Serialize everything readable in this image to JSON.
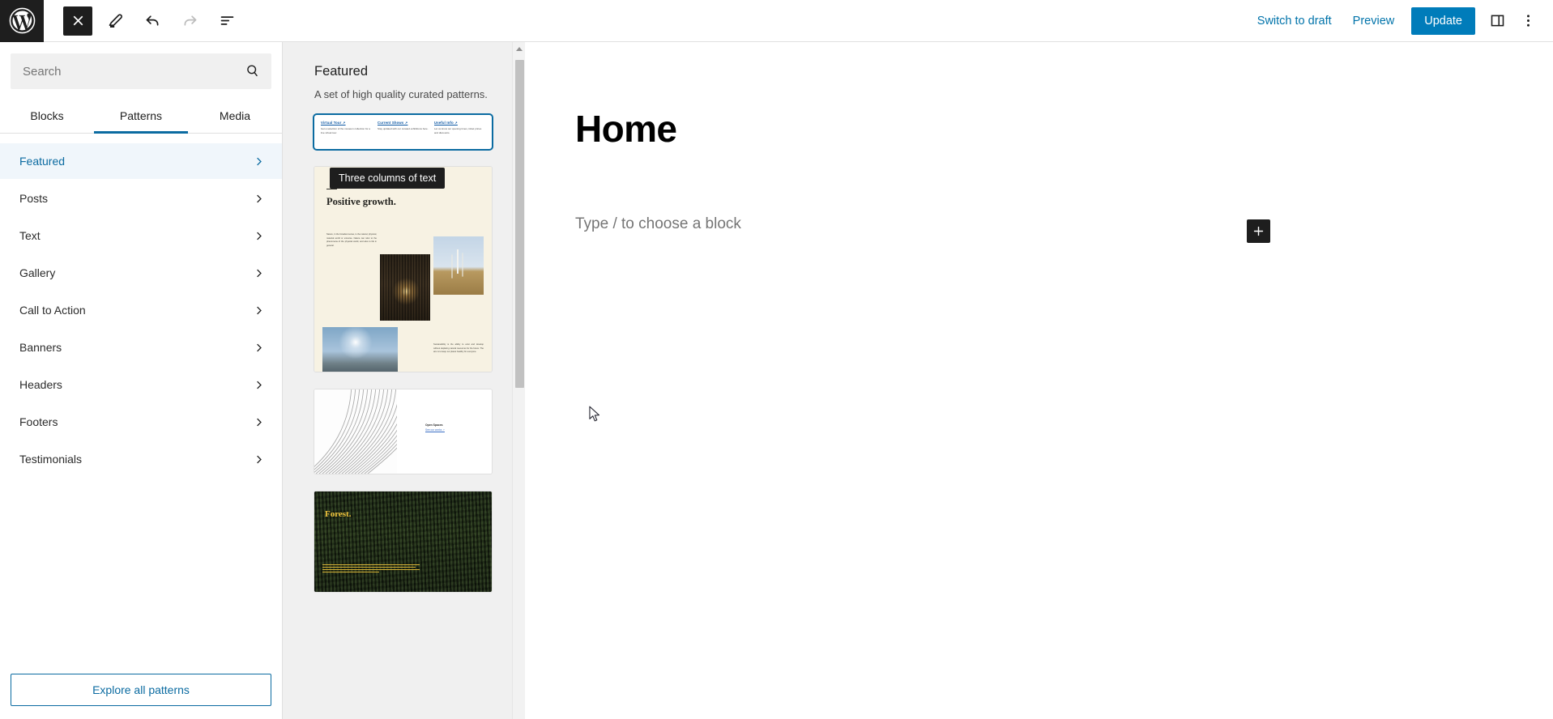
{
  "topbar": {
    "logo_icon": "wordpress-logo",
    "tools": [
      {
        "name": "close-inserter-button",
        "icon": "close-icon",
        "label": "Close block inserter"
      },
      {
        "name": "edit-mode-button",
        "icon": "pencil-icon",
        "label": "Tools"
      },
      {
        "name": "undo-button",
        "icon": "undo-icon",
        "label": "Undo"
      },
      {
        "name": "redo-button",
        "icon": "redo-icon",
        "label": "Redo"
      },
      {
        "name": "list-view-button",
        "icon": "list-view-icon",
        "label": "Document Overview"
      }
    ],
    "switch_to_draft": "Switch to draft",
    "preview": "Preview",
    "update": "Update",
    "settings_icon": "sidebar-toggle-icon",
    "options_icon": "more-options-icon"
  },
  "inserter": {
    "search": {
      "placeholder": "Search",
      "value": "",
      "icon": "search-icon"
    },
    "tabs": [
      {
        "label": "Blocks",
        "active": false
      },
      {
        "label": "Patterns",
        "active": true
      },
      {
        "label": "Media",
        "active": false
      }
    ],
    "categories": [
      {
        "label": "Featured",
        "active": true
      },
      {
        "label": "Posts",
        "active": false
      },
      {
        "label": "Text",
        "active": false
      },
      {
        "label": "Gallery",
        "active": false
      },
      {
        "label": "Call to Action",
        "active": false
      },
      {
        "label": "Banners",
        "active": false
      },
      {
        "label": "Headers",
        "active": false
      },
      {
        "label": "Footers",
        "active": false
      },
      {
        "label": "Testimonials",
        "active": false
      }
    ],
    "explore_button": "Explore all patterns"
  },
  "preview_panel": {
    "title": "Featured",
    "description": "A set of high quality curated patterns.",
    "tooltip": "Three columns of text",
    "patterns": [
      {
        "name": "three-columns-of-text",
        "selected": true,
        "columns": [
          {
            "link": "Virtual Tour ↗",
            "text": "Get a selection of the museum collection for a live virtual tour."
          },
          {
            "link": "Current Shows ↗",
            "text": "Stay updated with our curated exhibitions here."
          },
          {
            "link": "Useful Info ↗",
            "text": "Let us know our opening times, ticket prices and discounts."
          }
        ]
      },
      {
        "name": "positive-growth",
        "selected": false,
        "heading": "Positive growth.",
        "paragraph": "Nature, in the broadest sense, is the natural, physical, material world or universe. Nature can refer to the phenomena of the physical world, and also to life in general.",
        "paragraph2": "Sustainability is the ability to exist and develop without depleting natural resources for the future. The aim is to keep our planet healthy for everyone.",
        "background": "#f7f2e3"
      },
      {
        "name": "abstract-curves-text",
        "selected": false,
        "heading": "Open Spaces",
        "link": "See our works ↗"
      },
      {
        "name": "forest-cover",
        "selected": false,
        "heading": "Forest.",
        "accent": "#f0c33c"
      }
    ]
  },
  "canvas": {
    "document_title": "Home",
    "block_placeholder": "Type / to choose a block",
    "add_block_icon": "plus-icon"
  },
  "colors": {
    "accent": "#007cba",
    "link": "#0073aa",
    "active_category": "#0b6ba1",
    "dark": "#1e1e1e"
  }
}
